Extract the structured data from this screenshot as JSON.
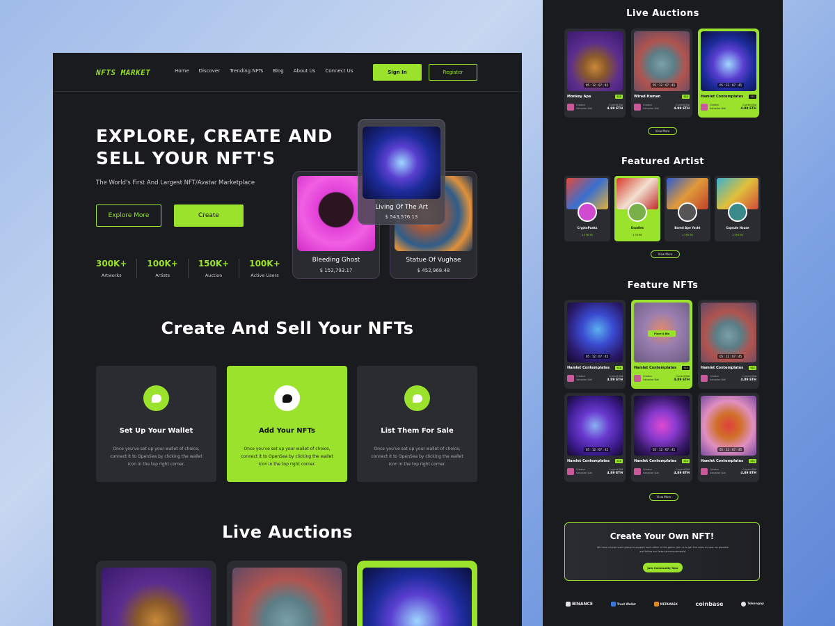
{
  "nav": {
    "logo": "NFTS MARKET",
    "links": [
      "Home",
      "Discover",
      "Trending NFTs",
      "Blog",
      "About Us",
      "Connect Us"
    ],
    "signin": "Sign In",
    "register": "Register"
  },
  "hero": {
    "title": "EXPLORE, CREATE AND SELL YOUR  NFT'S",
    "subtitle": "The World's First And Largest NFT/Avatar Marketplace",
    "explore": "Explore More",
    "create": "Create",
    "stats": [
      {
        "num": "300K+",
        "label": "Artworks"
      },
      {
        "num": "100K+",
        "label": "Artists"
      },
      {
        "num": "150K+",
        "label": "Auction"
      },
      {
        "num": "100K+",
        "label": "Active Users"
      }
    ],
    "cards": [
      {
        "name": "Bleeding Ghost",
        "price": "$ 152,793.17"
      },
      {
        "name": "Living Of The Art",
        "price": "$ 543,576.13"
      },
      {
        "name": "Statue Of Vughae",
        "price": "$ 452,968.48"
      }
    ]
  },
  "create_section": {
    "title": "Create And Sell Your NFTs",
    "steps": [
      {
        "title": "Set Up Your Wallet",
        "desc": "Once you've set up your wallet of choice, connect it to OpenSea by clicking the wallet icon in the top right corner."
      },
      {
        "title": "Add Your NFTs",
        "desc": "Once you've set up your wallet of choice, connect it to OpenSea by clicking the wallet icon in the top right corner."
      },
      {
        "title": "List Them For Sale",
        "desc": "Once you've set up your wallet of choice, connect it to OpenSea by clicking the wallet icon in the top right corner."
      }
    ]
  },
  "live_section": {
    "title": "Live Auctions"
  },
  "right": {
    "live_title": "Live Auctions",
    "live_cards": [
      {
        "name": "Monkey Ape",
        "timer": "05 : 12 : 07 : 45",
        "badge": "$$$",
        "creator_label": "Creator",
        "creator": "Salvador Dali",
        "bid_label": "Current Bid",
        "eth": "4.89 ETH"
      },
      {
        "name": "Wired Human",
        "timer": "05 : 12 : 07 : 45",
        "badge": "$$$",
        "creator_label": "Creator",
        "creator": "Salvador Dali",
        "bid_label": "Current Bid",
        "eth": "4.89 ETH"
      },
      {
        "name": "Hamlet Contemplates",
        "timer": "05 : 12 : 07 : 45",
        "badge": "$$$",
        "creator_label": "Creator",
        "creator": "Salvador Dali",
        "bid_label": "Current Bid",
        "eth": "4.89 ETH"
      }
    ],
    "view_more": "View More",
    "artist_title": "Featured Artist",
    "artists": [
      {
        "name": "CryptoPunks",
        "price": "‡ 376.78"
      },
      {
        "name": "Doodles",
        "price": "‡ 76.98"
      },
      {
        "name": "Bored Ape Yacht",
        "price": "‡ 376.78"
      },
      {
        "name": "Capsule House",
        "price": "‡ 376.78"
      }
    ],
    "feature_title": "Feature NFTs",
    "place_bid": "Place A Bid",
    "feature_cards": [
      {
        "name": "Hamlet Contemplates",
        "timer": "05 : 12 : 07 : 45",
        "badge": "$$$",
        "creator_label": "Creator",
        "creator": "Salvador Dali",
        "bid_label": "Current Bid",
        "eth": "4.89 ETH"
      },
      {
        "name": "Hamlet Contemplates",
        "timer": "05 : 12 : 07 : 45",
        "badge": "$$$",
        "creator_label": "Creator",
        "creator": "Salvador Dali",
        "bid_label": "Current Bid",
        "eth": "4.89 ETH"
      },
      {
        "name": "Hamlet Contemplates",
        "timer": "05 : 12 : 07 : 45",
        "badge": "$$$",
        "creator_label": "Creator",
        "creator": "Salvador Dali",
        "bid_label": "Current Bid",
        "eth": "4.89 ETH"
      },
      {
        "name": "Hamlet Contemplates",
        "timer": "05 : 12 : 07 : 45",
        "badge": "$$$",
        "creator_label": "Creator",
        "creator": "Salvador Dali",
        "bid_label": "Current Bid",
        "eth": "4.89 ETH"
      },
      {
        "name": "Hamlet Contemplates",
        "timer": "05 : 12 : 07 : 45",
        "badge": "$$$",
        "creator_label": "Creator",
        "creator": "Salvador Dali",
        "bid_label": "Current Bid",
        "eth": "4.89 ETH"
      },
      {
        "name": "Hamlet Contemplates",
        "timer": "05 : 12 : 07 : 45",
        "badge": "$$$",
        "creator_label": "Creator",
        "creator": "Salvador Dali",
        "bid_label": "Current Bid",
        "eth": "4.89 ETH"
      }
    ],
    "cta": {
      "title": "Create Your Own NFT!",
      "desc": "We have a large scale group to support each other in this game. Join us to get the news as soon as possible and follow our latest announcements!",
      "button": "Join Community Now"
    },
    "brands": [
      "BINANCE",
      "Trust Wallet",
      "METAMASK",
      "coinbase",
      "Tokenpay"
    ]
  },
  "colors": {
    "accent": "#9be22d",
    "panel": "#1a1b1e",
    "card": "#2a2c32"
  }
}
